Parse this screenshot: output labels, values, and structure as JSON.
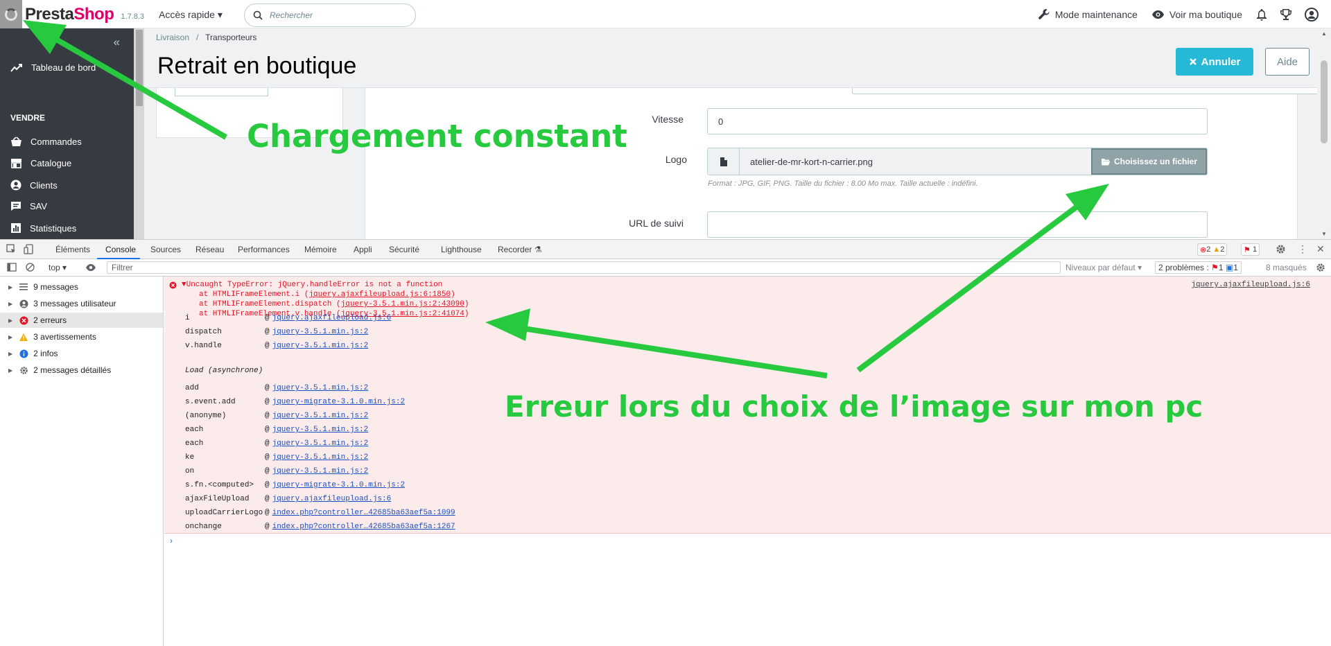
{
  "topbar": {
    "brand_presta": "Presta",
    "brand_shop": "Shop",
    "version": "1.7.8.3",
    "quick_access": "Accès rapide",
    "search_placeholder": "Rechercher",
    "maintenance": "Mode maintenance",
    "view_shop": "Voir ma boutique"
  },
  "sidebar": {
    "dashboard": "Tableau de bord",
    "section": "VENDRE",
    "items": [
      {
        "label": "Commandes",
        "icon": "basket-icon"
      },
      {
        "label": "Catalogue",
        "icon": "store-icon"
      },
      {
        "label": "Clients",
        "icon": "user-icon"
      },
      {
        "label": "SAV",
        "icon": "chat-icon"
      },
      {
        "label": "Statistiques",
        "icon": "chart-icon"
      }
    ]
  },
  "page": {
    "breadcrumb_parent": "Livraison",
    "breadcrumb_current": "Transporteurs",
    "title": "Retrait en boutique",
    "cancel_label": "Annuler",
    "help_label": "Aide"
  },
  "form": {
    "speed_label": "Vitesse",
    "speed_value": "0",
    "logo_label": "Logo",
    "logo_filename": "atelier-de-mr-kort-n-carrier.png",
    "choose_file_label": "Choisissez un fichier",
    "logo_help": "Format : JPG, GIF, PNG. Taille du fichier : 8.00 Mo max. Taille actuelle : indéfini.",
    "tracking_label": "URL de suivi",
    "tracking_value": ""
  },
  "devtools": {
    "tabs": [
      "Éléments",
      "Console",
      "Sources",
      "Réseau",
      "Performances",
      "Mémoire",
      "Appli",
      "Sécurité",
      "Lighthouse",
      "Recorder"
    ],
    "active_tab": "Console",
    "errors_count": "2",
    "warnings_count": "2",
    "issues_count": "1",
    "context": "top",
    "filter_placeholder": "Filtrer",
    "levels": "Niveaux par défaut",
    "problems_label": "2 problèmes :",
    "problems_error": "1",
    "problems_info": "1",
    "masked": "8 masqués",
    "sidebar_items": [
      {
        "label": "9 messages",
        "icon": "list-icon"
      },
      {
        "label": "3 messages utilisateur",
        "icon": "user-icon"
      },
      {
        "label": "2 erreurs",
        "icon": "error-icon"
      },
      {
        "label": "3 avertissements",
        "icon": "warning-icon"
      },
      {
        "label": "2 infos",
        "icon": "info-icon"
      },
      {
        "label": "2 messages détaillés",
        "icon": "gear-icon"
      }
    ],
    "error": {
      "message": "Uncaught TypeError: jQuery.handleError is not a function",
      "source": "jquery.ajaxfileupload.js:6",
      "at_lines": [
        {
          "prefix": "at HTMLIFrameElement.i (",
          "link": "jquery.ajaxfileupload.js:6:1850",
          "suffix": ")"
        },
        {
          "prefix": "at HTMLIFrameElement.dispatch (",
          "link": "jquery-3.5.1.min.js:2:43090",
          "suffix": ")"
        },
        {
          "prefix": "at HTMLIFrameElement.v.handle (",
          "link": "jquery-3.5.1.min.js:2:41074",
          "suffix": ")"
        }
      ],
      "stack": [
        {
          "fn": "i",
          "link": "jquery.ajaxfileupload.js:6"
        },
        {
          "fn": "dispatch",
          "link": "jquery-3.5.1.min.js:2"
        },
        {
          "fn": "v.handle",
          "link": "jquery-3.5.1.min.js:2"
        },
        {
          "fn": "add",
          "link": "jquery-3.5.1.min.js:2"
        },
        {
          "fn": "s.event.add",
          "link": "jquery-migrate-3.1.0.min.js:2"
        },
        {
          "fn": "(anonyme)",
          "link": "jquery-3.5.1.min.js:2"
        },
        {
          "fn": "each",
          "link": "jquery-3.5.1.min.js:2"
        },
        {
          "fn": "each",
          "link": "jquery-3.5.1.min.js:2"
        },
        {
          "fn": "ke",
          "link": "jquery-3.5.1.min.js:2"
        },
        {
          "fn": "on",
          "link": "jquery-3.5.1.min.js:2"
        },
        {
          "fn": "s.fn.<computed>",
          "link": "jquery-migrate-3.1.0.min.js:2"
        },
        {
          "fn": "ajaxFileUpload",
          "link": "jquery.ajaxfileupload.js:6"
        },
        {
          "fn": "uploadCarrierLogo",
          "link": "index.php?controller…42685ba63aef5a:1099"
        },
        {
          "fn": "onchange",
          "link": "index.php?controller…42685ba63aef5a:1267"
        }
      ],
      "async_label": "Load (asynchrone)"
    }
  },
  "annotations": {
    "loading": "Chargement constant",
    "error_note": "Erreur lors du choix de l’image sur mon pc"
  },
  "colors": {
    "accent": "#25b9d7",
    "brand_pink": "#df0067",
    "sidebar": "#363a41",
    "annotation_green": "#27c93f",
    "error_red": "#e81123"
  }
}
